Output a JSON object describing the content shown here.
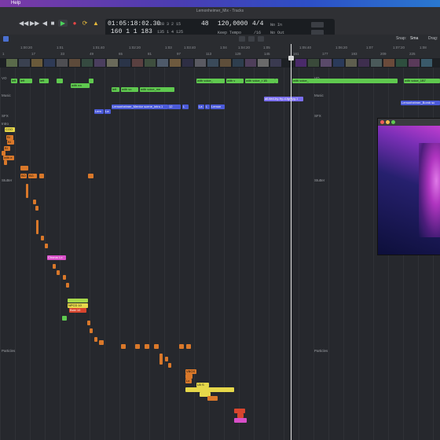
{
  "menubar": {
    "help": "Help"
  },
  "window": {
    "title": "Lemonheimer_Mix - Tracks"
  },
  "lcd": {
    "time": "01:05:18:02.30",
    "time_sub": "160  1  1  183",
    "pos_a": "128  3  2  15",
    "pos_b": "135  1  4  125",
    "bars": "48",
    "tempo": "120,0000",
    "tempo_label": "Keep Tempo",
    "sig": "4/4",
    "div": "/16",
    "in": "No In",
    "out": "No Out"
  },
  "toolbar": {
    "snap": "Snap:",
    "smart": "Sma",
    "drag": "Drag:"
  },
  "ruler": {
    "ticks": [
      "1:00:20",
      "1:01",
      "1:01:40",
      "1:02:20",
      "1:03",
      "1:03:40",
      "1:04",
      "1:04:20",
      "1:05",
      "1:05:40",
      "1:06:20",
      "1:07",
      "1:07:20",
      "1:08"
    ],
    "bars": [
      "1",
      "17",
      "33",
      "49",
      "65",
      "81",
      "97",
      "113",
      "129",
      "145",
      "161",
      "177",
      "193",
      "209",
      "225"
    ]
  },
  "tracks": {
    "vo": "VO",
    "vo_right": "VO",
    "music": "Music",
    "music_right": "Music",
    "sfx": "SFX",
    "sfx_right": "SFX",
    "intro": "Intro",
    "stutter": "Stutter",
    "stutter_right": "Stutter",
    "particles": "Particles",
    "particles_right": "Particles"
  },
  "regions": {
    "vo1": "left",
    "vo2": "left",
    "vo3": "left",
    "vo4": "with ea",
    "vo5": "left",
    "vo6": "with vo",
    "vo7": "with voice_me",
    "vo8": "with voice_",
    "vo9": "with v",
    "vo10": "with voice_t 1B",
    "vo11": "with voice_",
    "vo12": "with voice_1B7",
    "music_purple": "all-tied-by-fry-d-fgryyg.1",
    "music_blue": "Lemonheimer_Mentor scene_intro.1",
    "music_b1": "12",
    "music_b2": "L",
    "music_b3": "La",
    "music_b4": "L",
    "music_b5": "Lemon",
    "music_b6": "Lem",
    "music_b7": "La",
    "music_right": "Lemonheimer_Bomb sc",
    "intro1": "COO",
    "intro2": "BI",
    "intro3": "BI",
    "intro4": "BI",
    "intro5": "with e",
    "stutter1": "BO",
    "stutter2": "BG",
    "chorus": "Chorus Lo",
    "green1": "NPCD 10",
    "green2": "Bckt 10",
    "end1": "VBOX",
    "end2": "Lx",
    "end3": "LB S"
  },
  "colors": {
    "green": "#5fc94f",
    "blue": "#4b5ad8",
    "purple": "#7b6ff0",
    "orange": "#d9782a",
    "yellow": "#e6d84a",
    "pink": "#d84fc8",
    "red": "#d8452e"
  },
  "video_window": {
    "content": "purple-figure"
  }
}
